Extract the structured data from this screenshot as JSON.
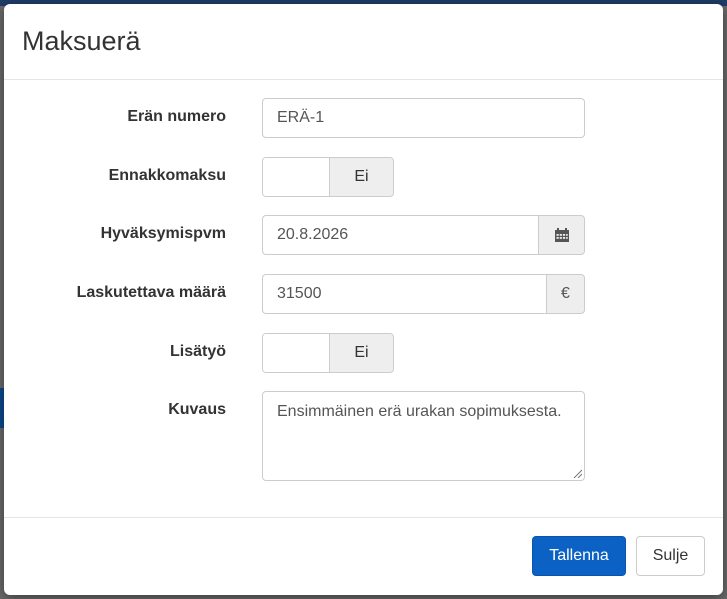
{
  "modal": {
    "title": "Maksuerä"
  },
  "form": {
    "batch_number": {
      "label": "Erän numero",
      "value": "ERÄ-1"
    },
    "advance_payment": {
      "label": "Ennakkomaksu",
      "state": "Ei"
    },
    "approval_date": {
      "label": "Hyväksymispvm",
      "value": "20.8.2026",
      "addon_icon": "calendar-icon"
    },
    "billable_amount": {
      "label": "Laskutettava määrä",
      "value": "31500",
      "currency": "€"
    },
    "additional_work": {
      "label": "Lisätyö",
      "state": "Ei"
    },
    "description": {
      "label": "Kuvaus",
      "value": "Ensimmäinen erä urakan sopimuksesta."
    }
  },
  "footer": {
    "save_label": "Tallenna",
    "close_label": "Sulje"
  },
  "colors": {
    "primary": "#0b62c4",
    "addon_bg": "#eeeeee",
    "border": "#cccccc"
  }
}
